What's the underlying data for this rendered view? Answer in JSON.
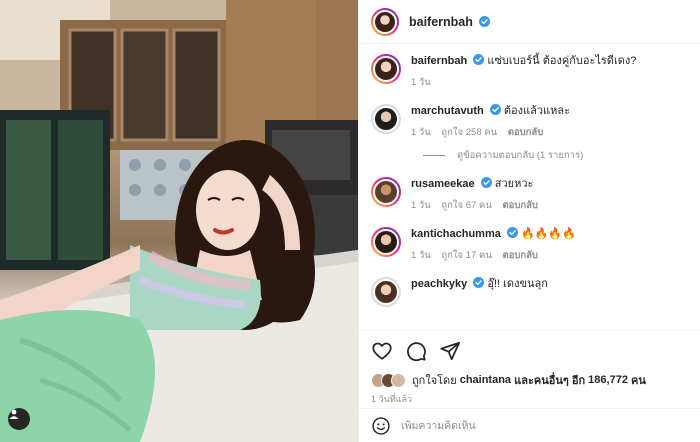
{
  "post": {
    "author": "baifernbah",
    "photo_alt": "baifernbah photo"
  },
  "colors": {
    "verified": "#3897f0",
    "muted": "#8e8e8e",
    "text": "#262626",
    "story_ring": "#ee2a7b"
  },
  "icons": {
    "verified": "verified-badge-icon",
    "like": "heart-icon",
    "comment": "speech-bubble-icon",
    "share": "paper-plane-icon",
    "emoji": "smiley-icon",
    "tagged": "user-tag-icon"
  },
  "caption": {
    "username": "baifernbah",
    "text": "แซ่บเบอร์นี้ ต้องคู่กับอะไรดีเดง?",
    "time": "1 วัน"
  },
  "comments": [
    {
      "username": "marchutavuth",
      "verified": true,
      "text": "ต้องแล้วแหละ",
      "time": "1 วัน",
      "likes": "ถูกใจ 258 คน",
      "reply_label": "ตอบกลับ",
      "view_replies": "ดูข้อความตอบกลับ (1 รายการ)"
    },
    {
      "username": "rusameekae",
      "verified": true,
      "text": "สวยหวะ",
      "time": "1 วัน",
      "likes": "ถูกใจ 67 คน",
      "reply_label": "ตอบกลับ"
    },
    {
      "username": "kantichachumma",
      "verified": true,
      "text": "🔥🔥🔥🔥",
      "time": "1 วัน",
      "likes": "ถูกใจ 17 คน",
      "reply_label": "ตอบกลับ"
    },
    {
      "username": "peachkyky",
      "verified": true,
      "text": "อุ๊!! เดงขนลุก"
    }
  ],
  "likes": {
    "prefix": "ถูกใจโดย",
    "first_user": "chaintana",
    "middle": "และคนอื่นๆ อีก",
    "count": "186,772",
    "suffix": "คน"
  },
  "timestamp": "1 วันที่แล้ว",
  "add_comment": {
    "placeholder": "เพิ่มความคิดเห็น"
  }
}
